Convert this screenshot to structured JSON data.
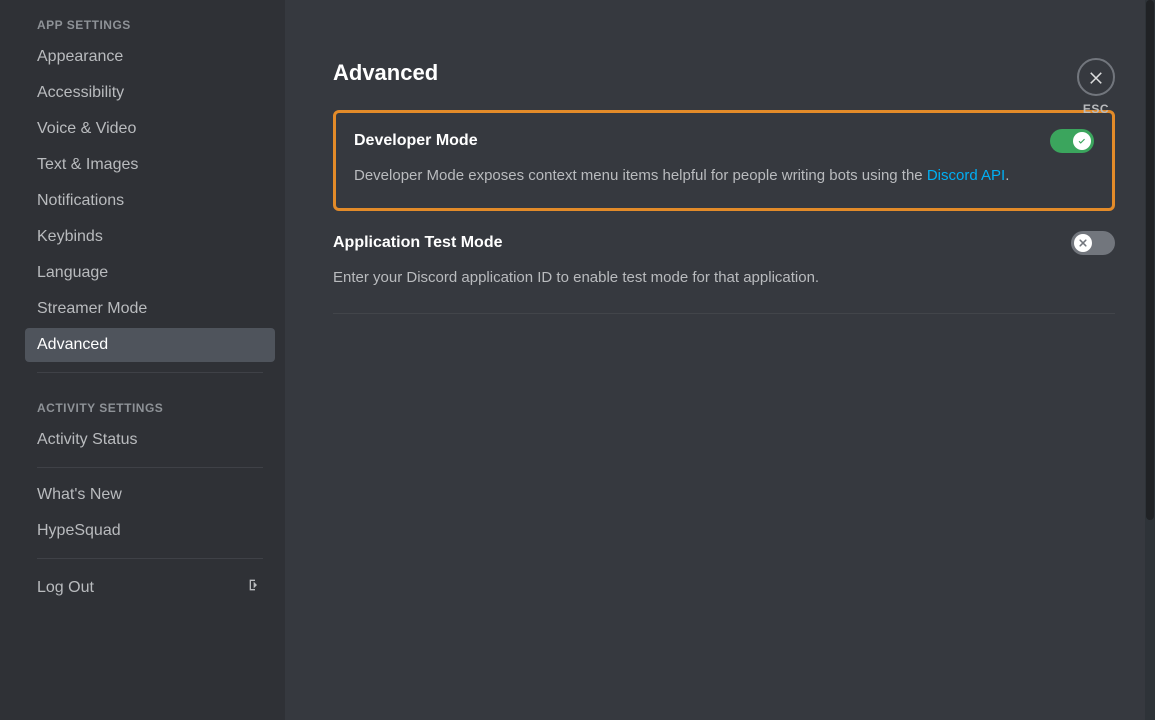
{
  "sidebar": {
    "sections": {
      "appSettings": {
        "header": "APP SETTINGS",
        "items": [
          "Appearance",
          "Accessibility",
          "Voice & Video",
          "Text & Images",
          "Notifications",
          "Keybinds",
          "Language",
          "Streamer Mode",
          "Advanced"
        ]
      },
      "activitySettings": {
        "header": "ACTIVITY SETTINGS",
        "items": [
          "Activity Status"
        ]
      },
      "misc": {
        "items": [
          "What's New",
          "HypeSquad"
        ]
      },
      "logout": "Log Out"
    },
    "activeItem": "Advanced"
  },
  "page": {
    "title": "Advanced",
    "developerMode": {
      "title": "Developer Mode",
      "descPrefix": "Developer Mode exposes context menu items helpful for people writing bots using the ",
      "link": "Discord API",
      "descSuffix": ".",
      "enabled": true
    },
    "appTestMode": {
      "title": "Application Test Mode",
      "desc": "Enter your Discord application ID to enable test mode for that application.",
      "enabled": false
    }
  },
  "close": {
    "label": "ESC"
  }
}
